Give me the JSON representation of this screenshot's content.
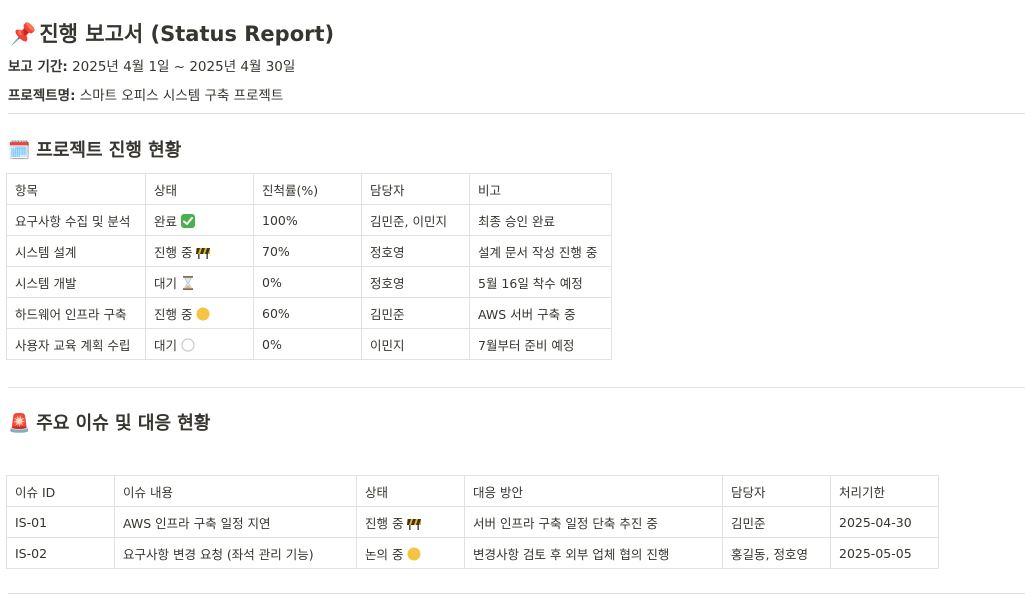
{
  "header": {
    "title_emoji": "📌",
    "title": "진행 보고서 (Status Report)",
    "period_label": "보고 기간:",
    "period_value": " 2025년 4월 1일 ~ 2025년 4월 30일",
    "project_label": "프로젝트명:",
    "project_value": " 스마트 오피스 시스템 구축 프로젝트"
  },
  "progress_section": {
    "heading_emoji": "🗓️",
    "heading": "프로젝트 진행 현황",
    "columns": [
      "항목",
      "상태",
      "진척률(%)",
      "담당자",
      "비고"
    ],
    "rows": [
      {
        "item": "요구사항 수집 및 분석",
        "status": "완료",
        "status_icon": "check-mark-icon",
        "progress": "100%",
        "owner": "김민준, 이민지",
        "note": "최종 승인 완료"
      },
      {
        "item": "시스템 설계",
        "status": "진행 중",
        "status_icon": "construction-icon",
        "progress": "70%",
        "owner": "정호영",
        "note": "설계 문서 작성 진행 중"
      },
      {
        "item": "시스템 개발",
        "status": "대기",
        "status_icon": "hourglass-icon",
        "progress": "0%",
        "owner": "정호영",
        "note": "5월 16일 착수 예정"
      },
      {
        "item": "하드웨어 인프라 구축",
        "status": "진행 중",
        "status_icon": "yellow-circle-icon",
        "progress": "60%",
        "owner": "김민준",
        "note": "AWS 서버 구축 중"
      },
      {
        "item": "사용자 교육 계획 수립",
        "status": "대기",
        "status_icon": "white-circle-icon",
        "progress": "0%",
        "owner": "이민지",
        "note": "7월부터 준비 예정"
      }
    ]
  },
  "issues_section": {
    "heading_emoji": "🚨",
    "heading": "주요 이슈 및 대응 현황",
    "columns": [
      "이슈 ID",
      "이슈 내용",
      "상태",
      "대응 방안",
      "담당자",
      "처리기한"
    ],
    "rows": [
      {
        "id": "IS-01",
        "content": "AWS 인프라 구축 일정 지연",
        "status": "진행 중",
        "status_icon": "construction-icon",
        "plan": "서버 인프라 구축 일정 단축 추진 중",
        "owner": "김민준",
        "due": "2025-04-30"
      },
      {
        "id": "IS-02",
        "content": "요구사항 변경 요청 (좌석 관리 기능)",
        "status": "논의 중",
        "status_icon": "yellow-circle-icon",
        "plan": "변경사항 검토 후 외부 업체 협의 진행",
        "owner": "홍길동, 정호영",
        "due": "2025-05-05"
      }
    ]
  },
  "colors": {
    "text": "#37352f",
    "border": "#e3e2e0",
    "check": "#4caf50",
    "yellow": "#f5c542",
    "construction_yellow": "#f2b705"
  }
}
